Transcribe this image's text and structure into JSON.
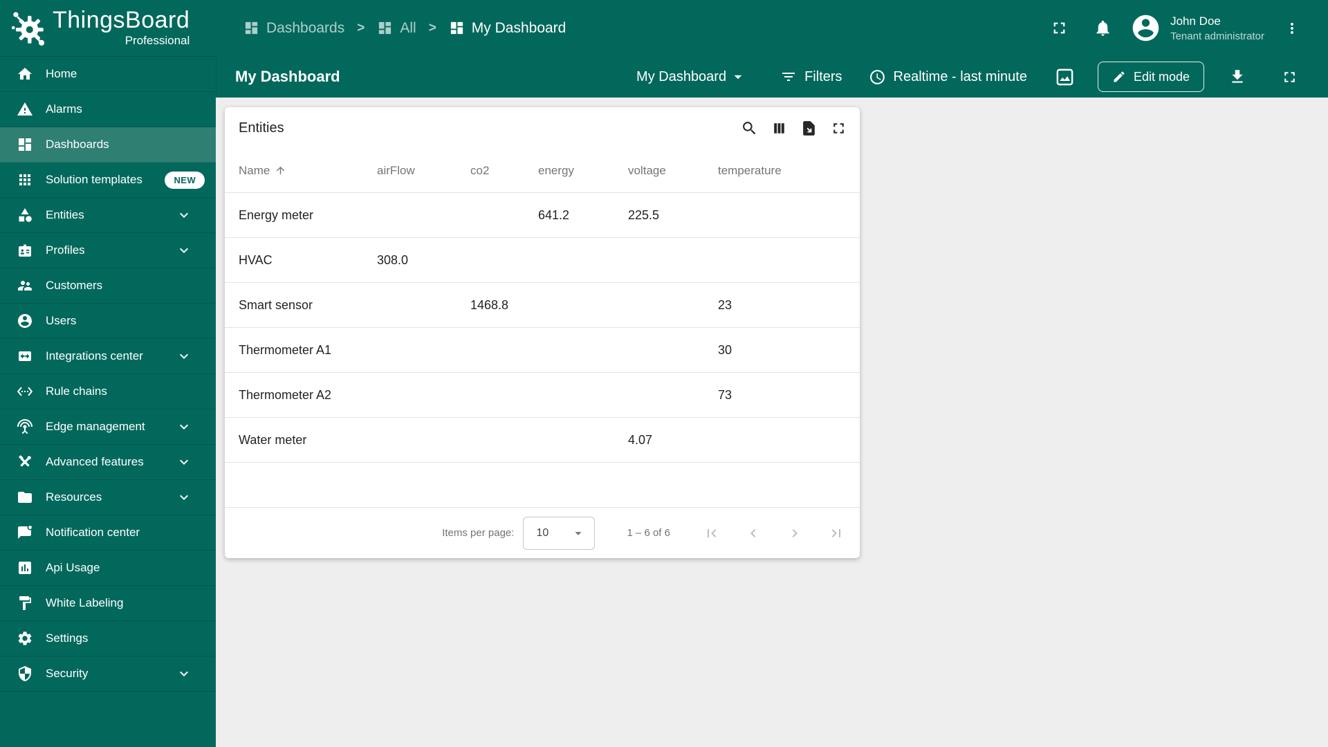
{
  "app": {
    "name": "ThingsBoard",
    "edition": "Professional"
  },
  "breadcrumb": {
    "separator": ">",
    "items": [
      {
        "label": "Dashboards"
      },
      {
        "label": "All"
      },
      {
        "label": "My Dashboard"
      }
    ]
  },
  "topbar": {
    "user": {
      "name": "John Doe",
      "role": "Tenant administrator"
    },
    "icons": [
      "fullscreen-icon",
      "notifications-bell-icon",
      "avatar",
      "more-vert-icon"
    ]
  },
  "toolbar": {
    "title": "My Dashboard",
    "state_select": "My Dashboard",
    "filters_label": "Filters",
    "timewindow_label": "Realtime - last minute",
    "edit_button_label": "Edit mode",
    "icons": [
      "dashboard-image-icon",
      "edit-pencil-icon",
      "download-icon",
      "fullscreen-icon"
    ]
  },
  "sidebar": {
    "items": [
      {
        "label": "Home",
        "icon": "home-icon"
      },
      {
        "label": "Alarms",
        "icon": "warning-icon"
      },
      {
        "label": "Dashboards",
        "icon": "dashboards-icon",
        "selected": true
      },
      {
        "label": "Solution templates",
        "icon": "apps-icon",
        "badge": "NEW"
      },
      {
        "label": "Entities",
        "icon": "category-icon",
        "expandable": true
      },
      {
        "label": "Profiles",
        "icon": "badge-icon",
        "expandable": true
      },
      {
        "label": "Customers",
        "icon": "people-icon"
      },
      {
        "label": "Users",
        "icon": "person-icon"
      },
      {
        "label": "Integrations center",
        "icon": "integration-icon",
        "expandable": true
      },
      {
        "label": "Rule chains",
        "icon": "rule-chain-icon"
      },
      {
        "label": "Edge management",
        "icon": "antenna-icon",
        "expandable": true
      },
      {
        "label": "Advanced features",
        "icon": "tools-icon",
        "expandable": true
      },
      {
        "label": "Resources",
        "icon": "folder-icon",
        "expandable": true
      },
      {
        "label": "Notification center",
        "icon": "chat-dot-icon"
      },
      {
        "label": "Api Usage",
        "icon": "chart-box-icon"
      },
      {
        "label": "White Labeling",
        "icon": "paint-roller-icon"
      },
      {
        "label": "Settings",
        "icon": "gear-icon"
      },
      {
        "label": "Security",
        "icon": "shield-icon",
        "expandable": true
      }
    ]
  },
  "widget": {
    "title": "Entities",
    "actions": [
      "search-icon",
      "view-columns-icon",
      "export-file-icon",
      "expand-icon"
    ],
    "table": {
      "columns": [
        "Name",
        "airFlow",
        "co2",
        "energy",
        "voltage",
        "temperature"
      ],
      "sort": {
        "column": "Name",
        "direction": "asc"
      },
      "rows": [
        [
          "Energy meter",
          "",
          "",
          "641.2",
          "225.5",
          ""
        ],
        [
          "HVAC",
          "308.0",
          "",
          "",
          "",
          ""
        ],
        [
          "Smart sensor",
          "",
          "1468.8",
          "",
          "",
          "23"
        ],
        [
          "Thermometer A1",
          "",
          "",
          "",
          "",
          "30"
        ],
        [
          "Thermometer A2",
          "",
          "",
          "",
          "",
          "73"
        ],
        [
          "Water meter",
          "",
          "",
          "",
          "4.07",
          ""
        ]
      ]
    },
    "pagination": {
      "items_per_page_label": "Items per page:",
      "items_per_page": "10",
      "range_label": "1 – 6 of 6"
    }
  },
  "colors": {
    "primary": "#03685C",
    "primary_selected": "#2F7F73",
    "content_bg": "#EEEEEE",
    "card_bg": "#FFFFFF",
    "header_text": "#757575",
    "row_divider": "#E4E4E4"
  }
}
